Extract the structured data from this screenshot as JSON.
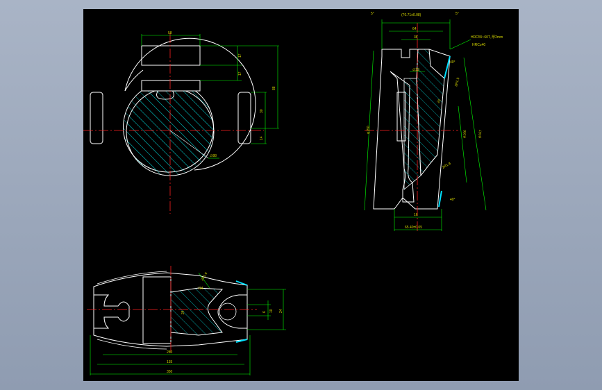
{
  "drawing": {
    "colors": {
      "background": "#000000",
      "outline": "#ffffff",
      "centerline": "#ff2020",
      "dimension": "#00ff00",
      "hatch": "#00c8c8",
      "text": "#d6d600",
      "highlight": "#00e0ff"
    },
    "top_view": {
      "dim_width": "58",
      "dim_17a": "17",
      "dim_17b": "17",
      "dim_88": "88",
      "dim_30": "30",
      "dim_14": "14",
      "dim_dia": "∅88"
    },
    "side_view": {
      "angle_left": "5°",
      "angle_right": "5°",
      "dim_top_tol": "(70.71±0.08)",
      "dim_64": "64",
      "dim_38": "38",
      "dim_23": "∅23",
      "dim_phi": "φ150",
      "dim_r1": "2R1.5",
      "dim_r2": "2R1.8",
      "dim_angle40a": "40°",
      "dim_angle40b": "40°",
      "dim_22": "22",
      "dim_phi167": "φ167",
      "dim_phi166": "φ166",
      "dim_16": "16",
      "dim_bottom": "65.40±0.05",
      "note_1": "HRC55~60T, 厚2mm",
      "note_2": "HRC≥40"
    },
    "front_view": {
      "dim_r": "2R1.6",
      "dim_r4": "R4",
      "dim_24": "24",
      "dim_6": "6",
      "dim_10": "10",
      "dim_24b": "24",
      "dim_280": "280",
      "dim_135": "135",
      "dim_350": "350"
    }
  }
}
